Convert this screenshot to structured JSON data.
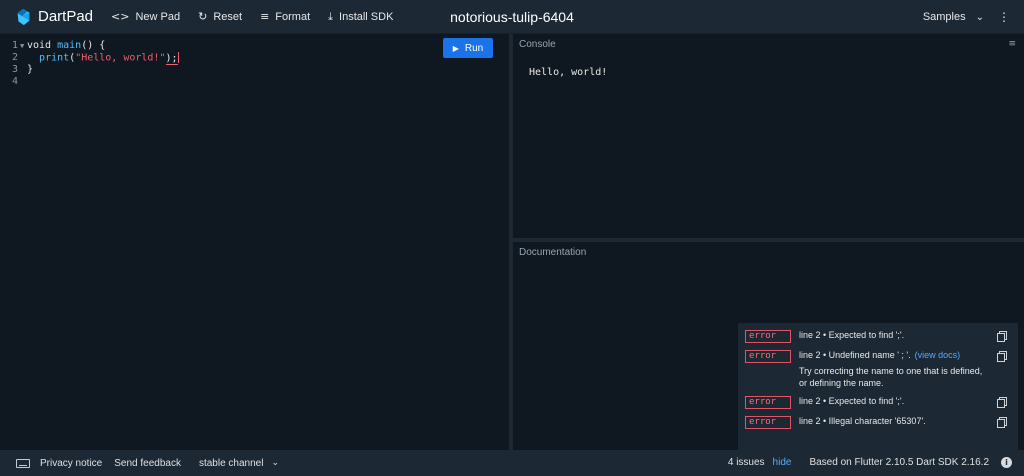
{
  "header": {
    "app_name": "DartPad",
    "buttons": [
      {
        "icon": "code-icon",
        "glyph": "<>",
        "label": "New Pad"
      },
      {
        "icon": "reset-icon",
        "glyph": "↻",
        "label": "Reset"
      },
      {
        "icon": "format-icon",
        "glyph": "≡",
        "label": "Format"
      },
      {
        "icon": "download-icon",
        "glyph": "⤓",
        "label": "Install SDK"
      }
    ],
    "pad_name": "notorious-tulip-6404",
    "samples_label": "Samples"
  },
  "editor": {
    "run_label": "Run",
    "lines": [
      {
        "number": "1",
        "folded": true
      },
      {
        "number": "2",
        "folded": false
      },
      {
        "number": "3",
        "folded": false
      },
      {
        "number": "4",
        "folded": false
      }
    ],
    "code": {
      "l1_kw": "void",
      "l1_fn": "main",
      "l1_rest": "() {",
      "l2_indent": "  ",
      "l2_fn": "print",
      "l2_open": "(",
      "l2_str": "\"Hello, world!\"",
      "l2_close": ")",
      "l2_semi": ";",
      "l3": "}"
    }
  },
  "console": {
    "label": "Console",
    "output": "Hello, world!"
  },
  "documentation": {
    "label": "Documentation"
  },
  "issues": [
    {
      "type": "error",
      "message": "line 2 • Expected to find ';'."
    },
    {
      "type": "error",
      "message": "line 2 • Undefined name ' ; '.",
      "link": "(view docs)",
      "fix": "Try correcting the name to one that is defined, or defining the name."
    },
    {
      "type": "error",
      "message": "line 2 • Expected to find ';'."
    },
    {
      "type": "error",
      "message": "line 2 • Illegal character '65307'."
    }
  ],
  "footer": {
    "privacy": "Privacy notice",
    "feedback": "Send feedback",
    "channel": "stable channel",
    "issue_count": "4 issues",
    "hide": "hide",
    "sdk_info": "Based on Flutter 2.10.5 Dart SDK 2.16.2"
  },
  "colors": {
    "background": "#1c2834",
    "editor_bg": "#0f1720",
    "accent": "#1a73e8",
    "error": "#f05d6b",
    "link": "#5aa9ff"
  }
}
